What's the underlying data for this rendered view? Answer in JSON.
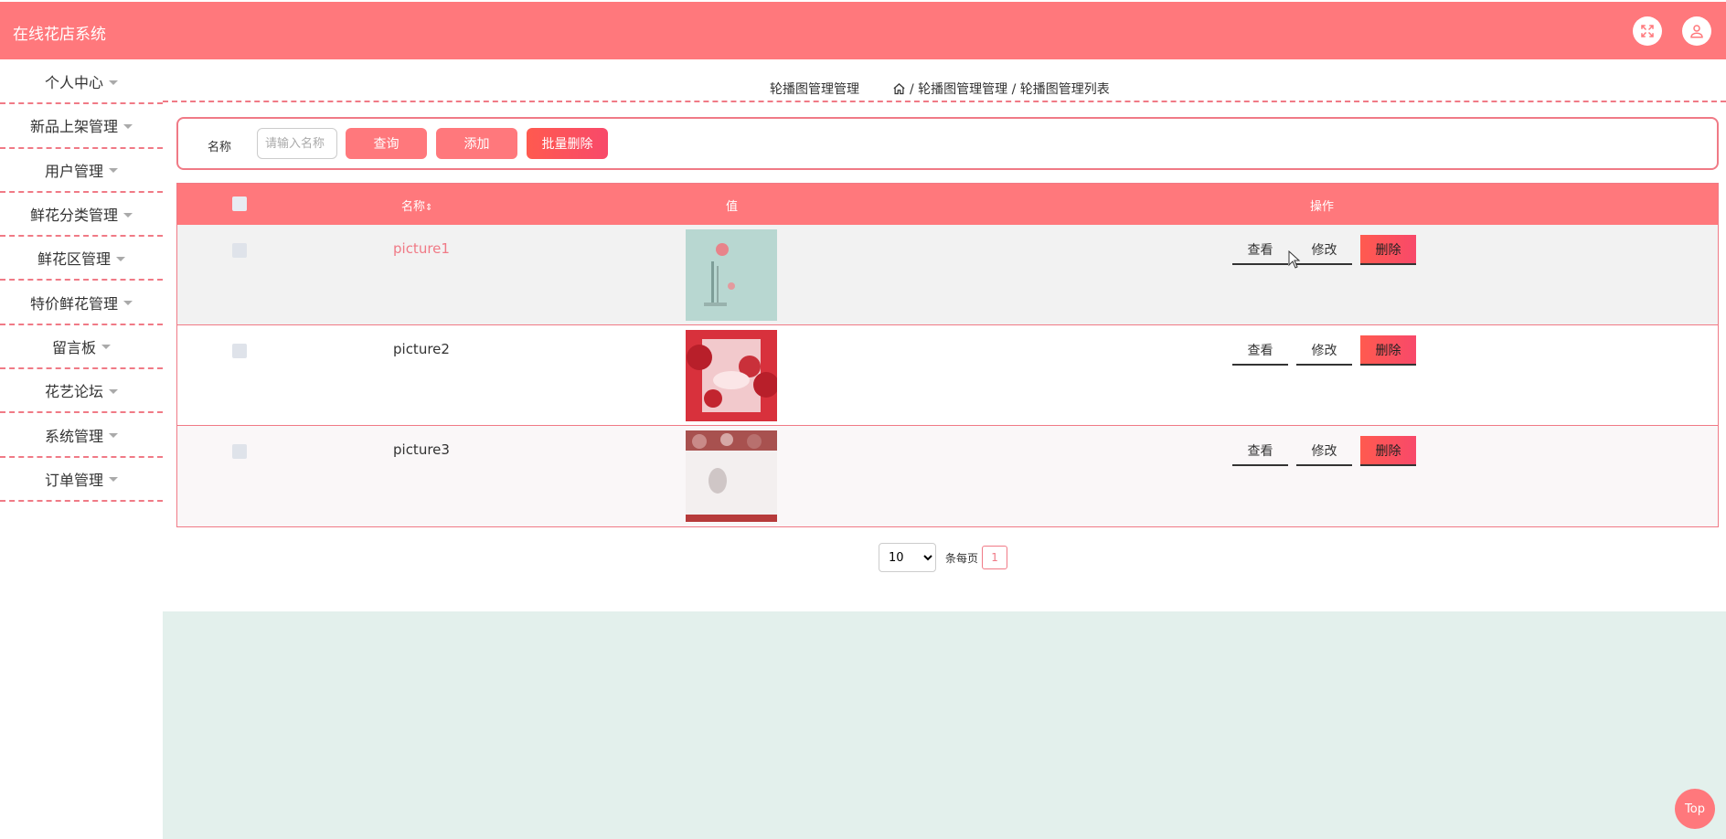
{
  "app": {
    "title": "在线花店系统"
  },
  "header": {
    "fullscreen_icon": "expand-icon",
    "user_icon": "user-icon"
  },
  "sidebar": {
    "items": [
      {
        "label": "个人中心"
      },
      {
        "label": "新品上架管理"
      },
      {
        "label": "用户管理"
      },
      {
        "label": "鲜花分类管理"
      },
      {
        "label": "鲜花区管理"
      },
      {
        "label": "特价鲜花管理"
      },
      {
        "label": "留言板"
      },
      {
        "label": "花艺论坛"
      },
      {
        "label": "系统管理"
      },
      {
        "label": "订单管理"
      }
    ]
  },
  "breadcrumb": {
    "page_title": "轮播图管理管理",
    "path": "/ 轮播图管理管理 / 轮播图管理列表"
  },
  "search": {
    "label": "名称",
    "placeholder": "请输入名称",
    "query_label": "查询",
    "add_label": "添加",
    "batch_delete_label": "批量删除"
  },
  "table": {
    "headers": {
      "name": "名称",
      "value": "值",
      "actions": "操作"
    },
    "rows": [
      {
        "name": "picture1",
        "name_color": "#f07a86",
        "bg": "#f2f2f2"
      },
      {
        "name": "picture2",
        "name_color": "#333333",
        "bg": "#ffffff"
      },
      {
        "name": "picture3",
        "name_color": "#333333",
        "bg": "#faf7f8"
      }
    ],
    "actions": {
      "view": "查看",
      "edit": "修改",
      "delete": "删除"
    }
  },
  "pagination": {
    "page_size": "10",
    "page_size_options": [
      "10"
    ],
    "per_page_label": "条每页",
    "current_page": "1"
  },
  "back_to_top": "Top",
  "colors": {
    "primary": "#ff787c",
    "danger": "#ff5a4f",
    "footer_bg": "#e3f0ec"
  }
}
